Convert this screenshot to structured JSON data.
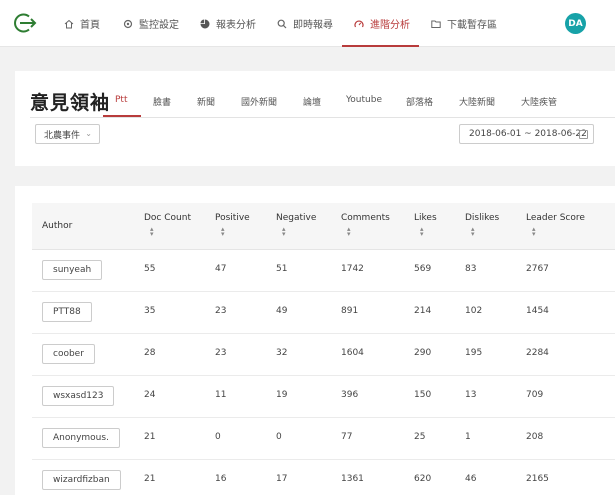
{
  "nav": {
    "items": [
      {
        "label": "首頁",
        "icon": "home-icon"
      },
      {
        "label": "監控設定",
        "icon": "gear-icon"
      },
      {
        "label": "報表分析",
        "icon": "pie-chart-icon"
      },
      {
        "label": "即時報尋",
        "icon": "search-icon"
      },
      {
        "label": "進階分析",
        "icon": "gauge-icon"
      },
      {
        "label": "下載暫存區",
        "icon": "folder-icon"
      }
    ],
    "active": "進階分析",
    "avatar": "DA"
  },
  "colors": {
    "accent": "#b83b3b",
    "avatar": "#17a2a8",
    "logo": "#2e7d32"
  },
  "header": {
    "title": "意見領袖",
    "tabs": [
      "Ptt",
      "臉書",
      "新聞",
      "國外新聞",
      "論壇",
      "Youtube",
      "部落格",
      "大陸新聞",
      "大陸疾管"
    ],
    "active_tab": "Ptt",
    "select_value": "北農事件",
    "date_range": "2018-06-01 ~ 2018-06-22"
  },
  "table": {
    "columns": [
      "Author",
      "Doc Count",
      "Positive",
      "Negative",
      "Comments",
      "Likes",
      "Dislikes",
      "Leader Score"
    ],
    "rows": [
      {
        "author": "sunyeah",
        "doc_count": "55",
        "positive": "47",
        "negative": "51",
        "comments": "1742",
        "likes": "569",
        "dislikes": "83",
        "score": "2767"
      },
      {
        "author": "PTT88",
        "doc_count": "35",
        "positive": "23",
        "negative": "49",
        "comments": "891",
        "likes": "214",
        "dislikes": "102",
        "score": "1454"
      },
      {
        "author": "coober",
        "doc_count": "28",
        "positive": "23",
        "negative": "32",
        "comments": "1604",
        "likes": "290",
        "dislikes": "195",
        "score": "2284"
      },
      {
        "author": "wsxasd123",
        "doc_count": "24",
        "positive": "11",
        "negative": "19",
        "comments": "396",
        "likes": "150",
        "dislikes": "13",
        "score": "709"
      },
      {
        "author": "Anonymous.",
        "doc_count": "21",
        "positive": "0",
        "negative": "0",
        "comments": "77",
        "likes": "25",
        "dislikes": "1",
        "score": "208"
      },
      {
        "author": "wizardfizban",
        "doc_count": "21",
        "positive": "16",
        "negative": "17",
        "comments": "1361",
        "likes": "620",
        "dislikes": "46",
        "score": "2165"
      }
    ]
  }
}
